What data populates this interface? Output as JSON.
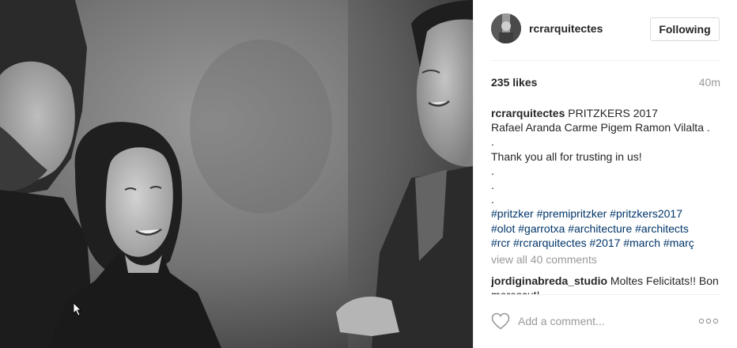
{
  "post": {
    "photo": {
      "alt": "",
      "icon": "photo-image"
    },
    "header": {
      "username": "rcrarquitectes",
      "follow_label": "Following"
    },
    "likes": "235 likes",
    "time": "40m",
    "caption": {
      "username": "rcrarquitectes",
      "title": "PRITZKERS 2017",
      "names": "Rafael Aranda Carme Pigem Ramon Vilalta .",
      "dot1": ".",
      "thanks": "Thank you all for trusting in us!",
      "dot2": ".",
      "dot3": ".",
      "dot4": ".",
      "hashtags_line1": [
        "#pritzker",
        "#premipritzker",
        "#pritzkers2017"
      ],
      "hashtags_line2": [
        "#olot",
        "#garrotxa",
        "#architecture",
        "#architects"
      ],
      "hashtags_line3": [
        "#rcr",
        "#rcrarquitectes",
        "#2017",
        "#march",
        "#març"
      ]
    },
    "view_all": "view all 40 comments",
    "comments": [
      {
        "user": "jordiginabreda_studio",
        "text": "Moltes Felicitats!! Bon merescut!"
      }
    ],
    "add_comment": {
      "placeholder": "Add a comment...",
      "heart_icon": "heart-outline-icon",
      "more_icon": "more-options-icon"
    },
    "colors": {
      "hashtag": "#003569",
      "muted": "#999999",
      "text": "#262626",
      "border": "#dbdbdb"
    }
  }
}
